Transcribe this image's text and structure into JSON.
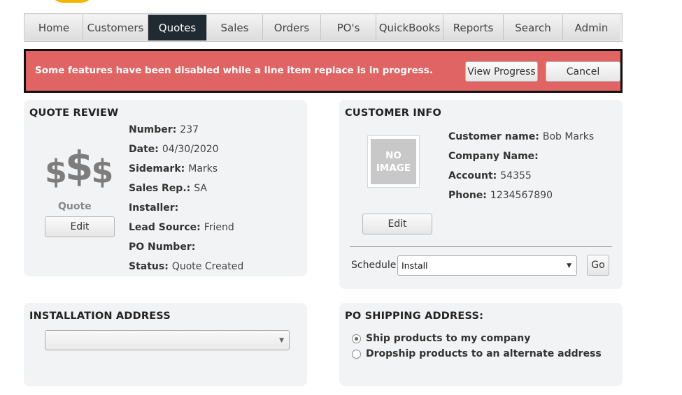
{
  "nav": {
    "tabs": [
      "Home",
      "Customers",
      "Quotes",
      "Sales",
      "Orders",
      "PO's",
      "QuickBooks",
      "Reports",
      "Search",
      "Admin"
    ],
    "active_tab": "Quotes"
  },
  "alert": {
    "message": "Some features have been disabled while a line item replace is in progress.",
    "view_progress_label": "View Progress",
    "cancel_label": "Cancel",
    "color": "#e06464"
  },
  "quote_review": {
    "title": "QUOTE REVIEW",
    "icon_text": "$$$",
    "icon_label": "Quote",
    "edit_label": "Edit",
    "fields": [
      {
        "label": "Number:",
        "value": "237"
      },
      {
        "label": "Date:",
        "value": "04/30/2020"
      },
      {
        "label": "Sidemark:",
        "value": "Marks"
      },
      {
        "label": "Sales Rep.:",
        "value": "SA"
      },
      {
        "label": "Installer:",
        "value": ""
      },
      {
        "label": "Lead Source:",
        "value": "Friend"
      },
      {
        "label": "PO Number:",
        "value": ""
      },
      {
        "label": "Status:",
        "value": "Quote Created"
      }
    ]
  },
  "customer_info": {
    "title": "CUSTOMER INFO",
    "no_image_line1": "NO",
    "no_image_line2": "IMAGE",
    "edit_label": "Edit",
    "fields": [
      {
        "label": "Customer name:",
        "value": "Bob Marks"
      },
      {
        "label": "Company Name:",
        "value": ""
      },
      {
        "label": "Account:",
        "value": "54355"
      },
      {
        "label": "Phone:",
        "value": "1234567890"
      }
    ],
    "schedule_label": "Schedule:",
    "schedule_value": "Install",
    "go_label": "Go"
  },
  "installation_address": {
    "title": "INSTALLATION ADDRESS",
    "selected": ""
  },
  "po_shipping": {
    "title": "PO SHIPPING ADDRESS:",
    "options": [
      {
        "label": "Ship products to my company",
        "checked": true
      },
      {
        "label": "Dropship products to an alternate address",
        "checked": false
      }
    ]
  }
}
